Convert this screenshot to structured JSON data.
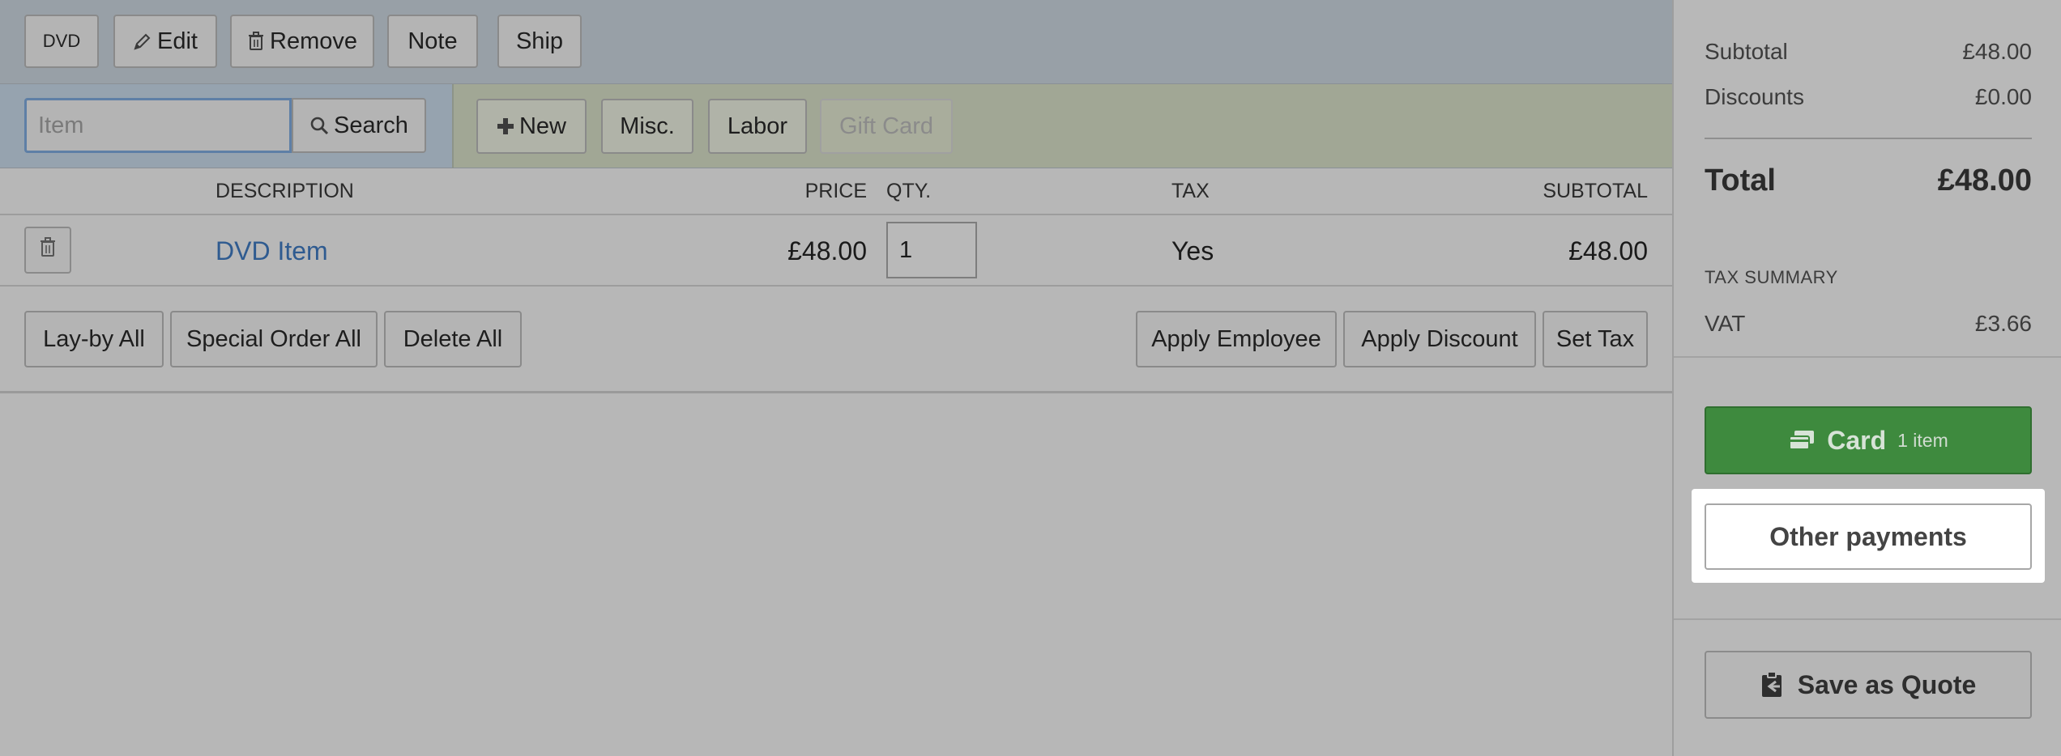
{
  "toolbar": {
    "dvd_label": "DVD",
    "edit_label": "Edit",
    "remove_label": "Remove",
    "note_label": "Note",
    "ship_label": "Ship"
  },
  "item_search": {
    "placeholder": "Item",
    "search_label": "Search"
  },
  "add_buttons": {
    "new_label": "New",
    "misc_label": "Misc.",
    "labor_label": "Labor",
    "gift_card_label": "Gift Card"
  },
  "table": {
    "headers": {
      "description": "DESCRIPTION",
      "price": "PRICE",
      "qty": "QTY.",
      "tax": "TAX",
      "subtotal": "SUBTOTAL"
    },
    "rows": [
      {
        "description": "DVD Item",
        "price": "£48.00",
        "qty": "1",
        "tax": "Yes",
        "subtotal": "£48.00"
      }
    ]
  },
  "bulk_actions": {
    "layby_all": "Lay-by All",
    "special_order_all": "Special Order All",
    "delete_all": "Delete All",
    "apply_employee": "Apply Employee",
    "apply_discount": "Apply Discount",
    "set_tax": "Set Tax"
  },
  "summary": {
    "subtotal_label": "Subtotal",
    "subtotal_value": "£48.00",
    "discounts_label": "Discounts",
    "discounts_value": "£0.00",
    "total_label": "Total",
    "total_value": "£48.00",
    "tax_summary_title": "TAX SUMMARY",
    "vat_label": "VAT",
    "vat_value": "£3.66"
  },
  "payments": {
    "card_label": "Card",
    "card_count": "1 item",
    "other_label": "Other payments",
    "quote_label": "Save as Quote"
  },
  "colors": {
    "card_green": "#3e8a3e",
    "link_blue": "#2f5b90"
  }
}
